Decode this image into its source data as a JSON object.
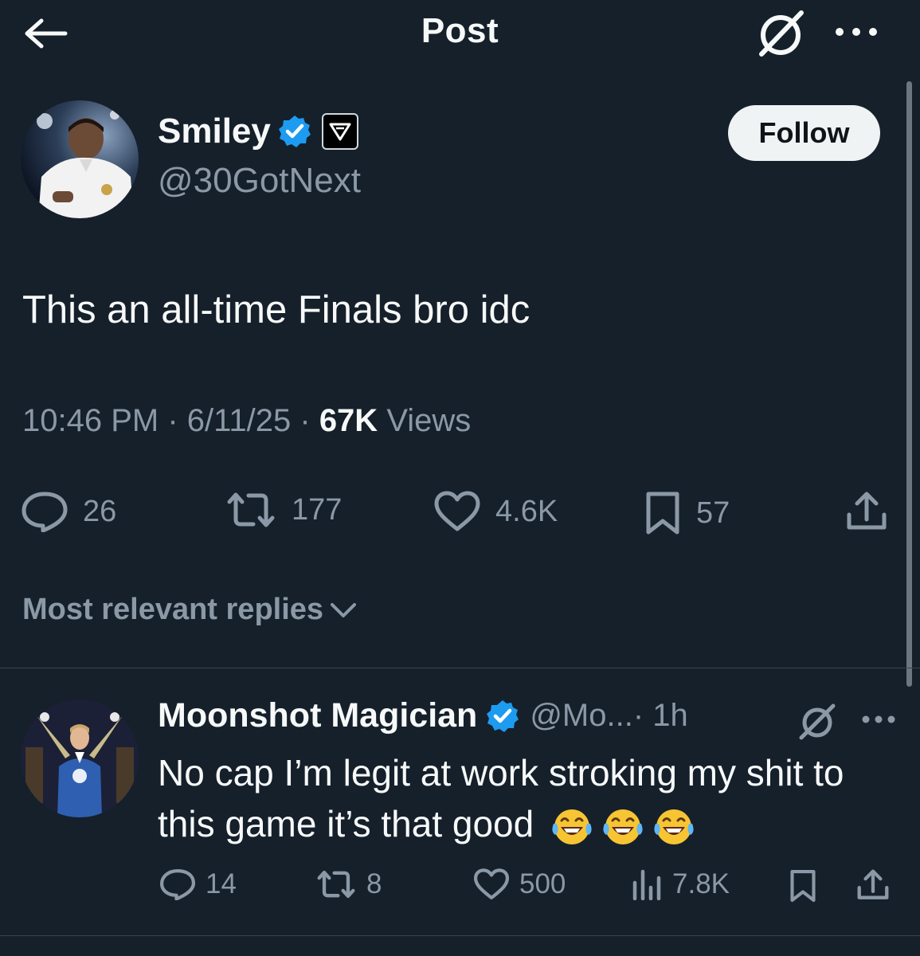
{
  "header": {
    "title": "Post",
    "back_icon": "arrow-left-icon",
    "grok_icon": "grok-icon",
    "more_icon": "more-horizontal-icon"
  },
  "tweet": {
    "author_name": "Smiley",
    "handle": "@30GotNext",
    "follow_label": "Follow",
    "text": "This an all-time Finals bro idc",
    "time": "10:46 PM",
    "date": "6/11/25",
    "views_count": "67K",
    "views_label": "Views",
    "separator": " · ",
    "stats": {
      "replies": "26",
      "reposts": "177",
      "likes": "4.6K",
      "bookmarks": "57"
    }
  },
  "replies_sort": {
    "label": "Most relevant replies"
  },
  "reply": {
    "author_name": "Moonshot Magician",
    "handle": "@Mo...",
    "time": " · 1h",
    "text": "No cap I’m legit at work stroking my shit to this game it’s that good",
    "emoji_count": 3,
    "stats": {
      "replies": "14",
      "reposts": "8",
      "likes": "500",
      "views": "7.8K"
    }
  },
  "colors": {
    "background": "#15202b",
    "text_primary": "#f7f9f9",
    "text_secondary": "#8b98a5",
    "verified": "#1d9bf0",
    "divider": "#38444d",
    "follow_bg": "#eff3f4"
  }
}
